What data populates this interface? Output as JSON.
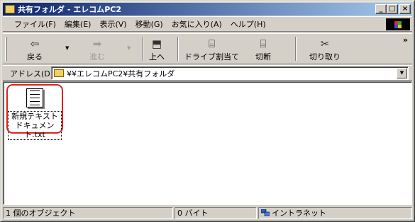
{
  "window": {
    "title": "共有フォルダ - エレコムPC2",
    "minimize_glyph": "_",
    "maximize_glyph": "□",
    "close_glyph": "×",
    "icon": "folder-icon"
  },
  "menu": {
    "items": [
      {
        "label": "ファイル(F)"
      },
      {
        "label": "編集(E)"
      },
      {
        "label": "表示(V)"
      },
      {
        "label": "移動(G)"
      },
      {
        "label": "お気に入り(A)"
      },
      {
        "label": "ヘルプ(H)"
      }
    ]
  },
  "toolbar": {
    "back": {
      "label": "戻る",
      "glyph": "⇦"
    },
    "forward": {
      "label": "進む",
      "glyph": "➡"
    },
    "up": {
      "label": "上へ",
      "glyph": "⬒"
    },
    "map_drive": {
      "label": "ドライブ割当て",
      "glyph": "⌸"
    },
    "disconnect": {
      "label": "切断",
      "glyph": "⌸"
    },
    "cut": {
      "label": "切り取り",
      "glyph": "✂"
    },
    "dropdown_glyph": "▼",
    "more_glyph": "»"
  },
  "address": {
    "label": "アドレス(D)",
    "value": "¥¥エレコムPC2¥共有フォルダ",
    "dropdown_glyph": "▼"
  },
  "content": {
    "files": [
      {
        "line1": "新規テキスト",
        "line2": "ドキュメント.txt",
        "icon": "text-file-icon"
      }
    ]
  },
  "status": {
    "objects": "1 個のオブジェクト",
    "size": "0 バイト",
    "zone": "イントラネット"
  },
  "colors": {
    "title_start": "#0a246a",
    "title_end": "#a6caf0",
    "face": "#d4d0c8",
    "highlight_ring": "#e02020"
  }
}
